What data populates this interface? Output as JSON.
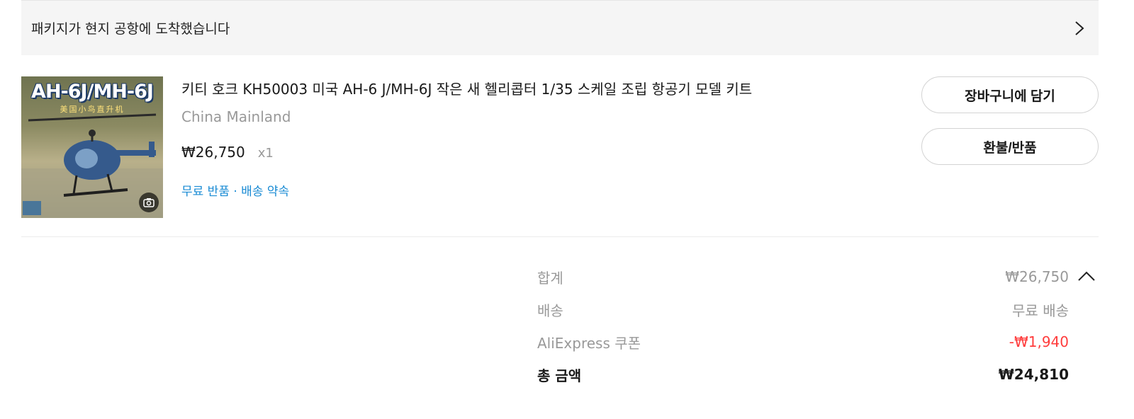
{
  "status": {
    "message": "패키지가 현지 공항에 도착했습니다",
    "icon": "chevron-right-icon"
  },
  "item": {
    "thumbnail_title": "AH-6J/MH-6J",
    "thumbnail_sub": "美国小鸟直升机",
    "title": "키티 호크 KH50003 미국 AH-6 J/MH-6J 작은 새 헬리콥터 1/35 스케일 조립 항공기 모델 키트",
    "origin": "China Mainland",
    "price": "₩26,750",
    "qty": "x1",
    "promise": "무료 반품 · 배송 약속",
    "buttons": {
      "cart": "장바구니에 담기",
      "refund": "환불/반품"
    }
  },
  "summary": {
    "rows": [
      {
        "label": "합계",
        "value": "₩26,750"
      },
      {
        "label": "배송",
        "value": "무료 배송"
      },
      {
        "label": "AliExpress 쿠폰",
        "value": "-₩1,940"
      },
      {
        "label": "총 금액",
        "value": "₩24,810"
      }
    ],
    "colors": {
      "discount": "#ff3c3c",
      "link": "#1a8bd4"
    }
  }
}
